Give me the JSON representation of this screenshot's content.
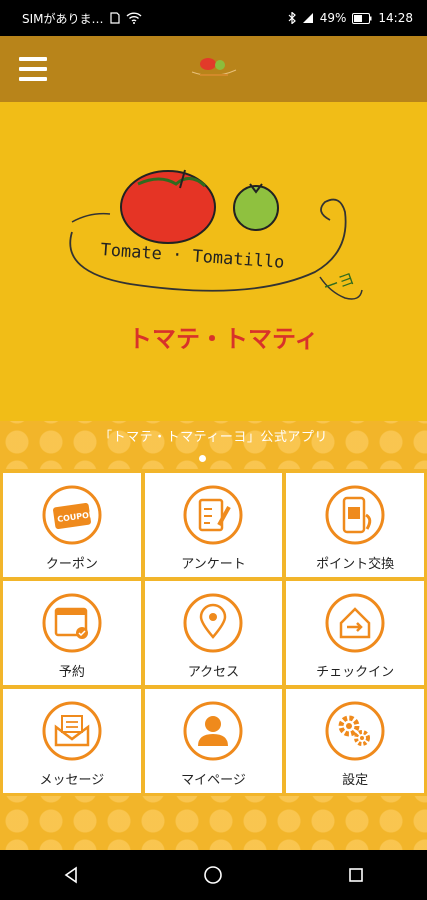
{
  "status_bar": {
    "carrier": "SIMがありま…",
    "battery": "49%",
    "time": "14:28"
  },
  "header": {
    "menu_icon": "hamburger-icon"
  },
  "hero": {
    "logo_text_en": "Tomate · Tomatillo",
    "logo_text_jp": "トマテ・トマティ",
    "logo_text_jp_end": "ーヨ"
  },
  "caption": "「トマテ・トマティーヨ」公式アプリ",
  "menu": {
    "tiles": [
      {
        "label": "クーポン",
        "icon": "coupon-icon"
      },
      {
        "label": "アンケート",
        "icon": "survey-icon"
      },
      {
        "label": "ポイント交換",
        "icon": "point-exchange-icon"
      },
      {
        "label": "予約",
        "icon": "calendar-icon"
      },
      {
        "label": "アクセス",
        "icon": "map-pin-icon"
      },
      {
        "label": "チェックイン",
        "icon": "checkin-icon"
      },
      {
        "label": "メッセージ",
        "icon": "message-icon"
      },
      {
        "label": "マイページ",
        "icon": "user-icon"
      },
      {
        "label": "設定",
        "icon": "gears-icon"
      }
    ],
    "coupon_badge": "COUPON"
  },
  "colors": {
    "header": "#b8841a",
    "hero": "#f1bd17",
    "accent": "#ef8a1c",
    "band": "#f2b52a"
  }
}
